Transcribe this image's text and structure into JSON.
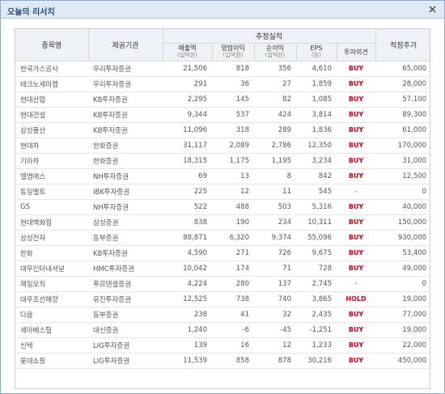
{
  "window": {
    "title": "오늘의 리서치",
    "close_icon": "close-icon"
  },
  "table": {
    "headers": {
      "name": "종목명",
      "broker": "제공기관",
      "group": "추정실적",
      "revenue": "매출액",
      "revenue_unit": "(십억원)",
      "op_income": "영업이익",
      "op_income_unit": "(십억원)",
      "net_income": "순이익",
      "net_income_unit": "(십억원)",
      "eps": "EPS",
      "eps_unit": "(원)",
      "opinion": "투자의견",
      "target": "적정주가"
    },
    "rows": [
      {
        "name": "한국가스공사",
        "broker": "우리투자증권",
        "revenue": "21,506",
        "op_income": "818",
        "net_income": "356",
        "eps": "4,610",
        "opinion": "BUY",
        "target": "65,000"
      },
      {
        "name": "테크노세미켐",
        "broker": "우리투자증권",
        "revenue": "291",
        "op_income": "36",
        "net_income": "27",
        "eps": "1,859",
        "opinion": "BUY",
        "target": "28,000"
      },
      {
        "name": "현대산업",
        "broker": "KB투자증권",
        "revenue": "2,295",
        "op_income": "145",
        "net_income": "82",
        "eps": "1,085",
        "opinion": "BUY",
        "target": "57,100"
      },
      {
        "name": "현대건설",
        "broker": "KB투자증권",
        "revenue": "9,344",
        "op_income": "537",
        "net_income": "424",
        "eps": "3,814",
        "opinion": "BUY",
        "target": "89,300"
      },
      {
        "name": "삼성물산",
        "broker": "KB투자증권",
        "revenue": "11,096",
        "op_income": "318",
        "net_income": "289",
        "eps": "1,836",
        "opinion": "BUY",
        "target": "61,000"
      },
      {
        "name": "현대차",
        "broker": "한화증권",
        "revenue": "31,117",
        "op_income": "2,089",
        "net_income": "2,786",
        "eps": "12,350",
        "opinion": "BUY",
        "target": "170,000"
      },
      {
        "name": "기아차",
        "broker": "한화증권",
        "revenue": "18,315",
        "op_income": "1,175",
        "net_income": "1,195",
        "eps": "3,234",
        "opinion": "BUY",
        "target": "31,000"
      },
      {
        "name": "엘엠에스",
        "broker": "NH투자증권",
        "revenue": "69",
        "op_income": "13",
        "net_income": "8",
        "eps": "842",
        "opinion": "BUY",
        "target": "12,500"
      },
      {
        "name": "동일벨트",
        "broker": "IBK투자증권",
        "revenue": "225",
        "op_income": "12",
        "net_income": "11",
        "eps": "545",
        "opinion": "-",
        "target": "0"
      },
      {
        "name": "GS",
        "broker": "NH투자증권",
        "revenue": "522",
        "op_income": "488",
        "net_income": "503",
        "eps": "5,316",
        "opinion": "BUY",
        "target": "40,000"
      },
      {
        "name": "현대백화점",
        "broker": "삼성증권",
        "revenue": "838",
        "op_income": "190",
        "net_income": "234",
        "eps": "10,311",
        "opinion": "BUY",
        "target": "150,000"
      },
      {
        "name": "삼성전자",
        "broker": "동부증권",
        "revenue": "88,871",
        "op_income": "6,320",
        "net_income": "9,374",
        "eps": "55,096",
        "opinion": "BUY",
        "target": "930,000"
      },
      {
        "name": "한화",
        "broker": "KB투자증권",
        "revenue": "4,590",
        "op_income": "271",
        "net_income": "726",
        "eps": "9,675",
        "opinion": "BUY",
        "target": "53,400"
      },
      {
        "name": "대우인터내셔널",
        "broker": "HMC투자증권",
        "revenue": "10,042",
        "op_income": "174",
        "net_income": "71",
        "eps": "728",
        "opinion": "BUY",
        "target": "49,000"
      },
      {
        "name": "제일모직",
        "broker": "푸르덴셜증권",
        "revenue": "4,224",
        "op_income": "280",
        "net_income": "137",
        "eps": "2,745",
        "opinion": "-",
        "target": "0"
      },
      {
        "name": "대우조선해양",
        "broker": "유진투자증권",
        "revenue": "12,525",
        "op_income": "738",
        "net_income": "740",
        "eps": "3,865",
        "opinion": "HOLD",
        "target": "19,000"
      },
      {
        "name": "다음",
        "broker": "동부증권",
        "revenue": "238",
        "op_income": "41",
        "net_income": "32",
        "eps": "2,435",
        "opinion": "BUY",
        "target": "77,000"
      },
      {
        "name": "세아베스틸",
        "broker": "대신증권",
        "revenue": "1,240",
        "op_income": "-6",
        "net_income": "-45",
        "eps": "-1,251",
        "opinion": "BUY",
        "target": "19,000"
      },
      {
        "name": "신텍",
        "broker": "LIG투자증권",
        "revenue": "139",
        "op_income": "16",
        "net_income": "12",
        "eps": "1,233",
        "opinion": "BUY",
        "target": "22,000"
      },
      {
        "name": "롯데쇼핑",
        "broker": "LIG투자증권",
        "revenue": "11,539",
        "op_income": "858",
        "net_income": "878",
        "eps": "30,216",
        "opinion": "BUY",
        "target": "450,000"
      }
    ]
  },
  "colors": {
    "buy": "#d0021b",
    "hold": "#d0021b",
    "header_bg": "#eef1f5",
    "title_bg": "#dfe9f6"
  }
}
